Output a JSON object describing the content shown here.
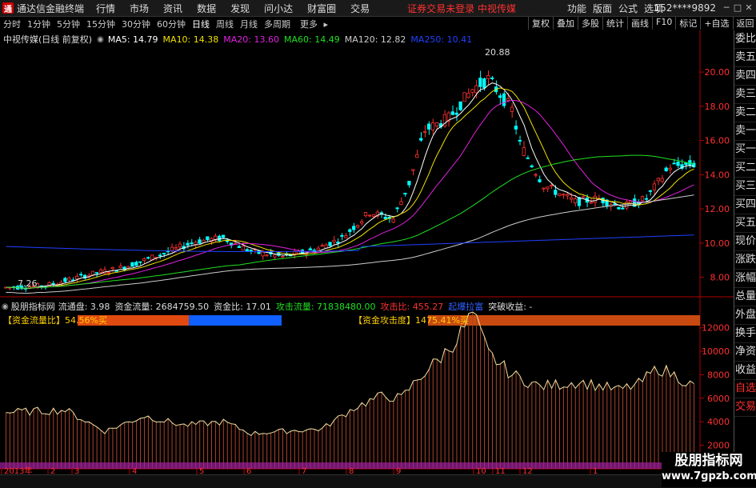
{
  "app": {
    "name": "通达信金融终端",
    "menus": [
      "行情",
      "市场",
      "资讯",
      "数据",
      "发现",
      "问小达",
      "财富圈",
      "交易"
    ],
    "notice": "证券交易未登录",
    "stock_short": "中视传媒",
    "right_menus": [
      "功能",
      "版面",
      "公式",
      "选项"
    ],
    "user": "152****9892"
  },
  "periods": [
    "分时",
    "1分钟",
    "5分钟",
    "15分钟",
    "30分钟",
    "60分钟",
    "日线",
    "周线",
    "月线",
    "多周期",
    "更多"
  ],
  "active_period": "日线",
  "top_tools": [
    "复权",
    "叠加",
    "多股",
    "统计",
    "画线",
    "F10",
    "标记",
    "+自选",
    "返回"
  ],
  "side_buttons": [
    "委比",
    "卖五",
    "卖四",
    "卖三",
    "卖二",
    "卖一",
    "买一",
    "买二",
    "买三",
    "买四",
    "买五",
    "现价",
    "涨跌",
    "涨幅",
    "总量",
    "外盘",
    "换手",
    "净资",
    "收益",
    "自选",
    "交易"
  ],
  "main_header": {
    "stock": "中视传媒(日线 前复权)",
    "ma": [
      {
        "label": "MA5: 14.79",
        "color": "#ffffff"
      },
      {
        "label": "MA10: 14.38",
        "color": "#f0e000"
      },
      {
        "label": "MA20: 13.60",
        "color": "#e020e0"
      },
      {
        "label": "MA60: 14.49",
        "color": "#20e020"
      },
      {
        "label": "MA120: 12.82",
        "color": "#cccccc"
      },
      {
        "label": "MA250: 10.41",
        "color": "#2040ff"
      }
    ]
  },
  "price_axis": {
    "ticks": [
      "20.00",
      "18.00",
      "16.00",
      "14.00",
      "12.00",
      "10.00",
      "8.00"
    ]
  },
  "price_marks": {
    "high": "20.88",
    "low": "7.26"
  },
  "indicator_header": {
    "name": "股朋指标网",
    "items": [
      {
        "label": "流通盘: 3.98",
        "color": "#dddddd"
      },
      {
        "label": "资金流量: 2684759.50",
        "color": "#dddddd"
      },
      {
        "label": "资金比: 17.01",
        "color": "#dddddd"
      },
      {
        "label": "攻击流量: 71838480.00",
        "color": "#20e020"
      },
      {
        "label": "攻击比: 455.27",
        "color": "#ff3030"
      },
      {
        "label": "起爆拉富",
        "color": "#3060ff"
      },
      {
        "label": "突破收益: -",
        "color": "#dddddd"
      }
    ]
  },
  "flow_bar": {
    "label": "【资金流量比】54.56%买",
    "buy_pct": 54.56
  },
  "attack_bar": {
    "label": "【资金攻击度】1475.41%买",
    "buy_pct": 100
  },
  "vol_axis": {
    "ticks": [
      "12000",
      "10000",
      "8000",
      "6000",
      "4000",
      "2000"
    ]
  },
  "x_axis": {
    "labels": [
      "2013年",
      "2",
      "3",
      "4",
      "5",
      "6",
      "7",
      "8",
      "9",
      "10",
      "11",
      "12",
      "1"
    ]
  },
  "watermark": {
    "line1": "股朋指标网",
    "line2": "www.7gpzb.com"
  },
  "colors": {
    "up": "#ff3030",
    "down": "#00ffff",
    "accent": "#ff3030"
  }
}
